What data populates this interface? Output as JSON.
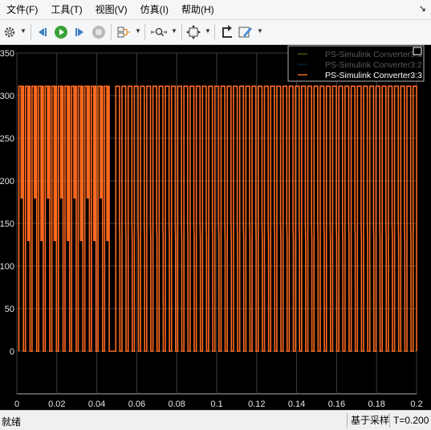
{
  "menu": {
    "items": [
      "文件(F)",
      "工具(T)",
      "视图(V)",
      "仿真(I)",
      "帮助(H)"
    ],
    "right_arrow": "↘"
  },
  "toolbar": {
    "icons": [
      "gear-icon",
      "step-back-icon",
      "run-icon",
      "step-forward-icon",
      "stop-icon",
      "signal-select-icon",
      "zoom-icon",
      "fit-view-icon",
      "restore-icon",
      "style-icon"
    ]
  },
  "status": {
    "text": "就绪",
    "sample": "基于采样",
    "time": "T=0.200"
  },
  "colors": {
    "background": "#000000",
    "axes_text": "#e6e6e6",
    "grid": "#3c3c3c",
    "series1": "#ffff00",
    "series2": "#0072bd",
    "series3": "#ff6a1f"
  },
  "chart_data": {
    "type": "line",
    "title": "",
    "xlabel": "",
    "ylabel": "",
    "xlim": [
      0,
      0.2
    ],
    "ylim": [
      -50,
      350
    ],
    "xticks": [
      "0",
      "0.02",
      "0.04",
      "0.06",
      "0.08",
      "0.1",
      "0.12",
      "0.14",
      "0.16",
      "0.18",
      "0.2"
    ],
    "yticks": [
      "0",
      "50",
      "100",
      "150",
      "200",
      "250",
      "300",
      "350"
    ],
    "grid": true,
    "legend_position": "top-right",
    "series": [
      {
        "name": "PS-Simulink Converter3:1",
        "values": [],
        "hidden": true
      },
      {
        "name": "PS-Simulink Converter3:2",
        "values": [],
        "hidden": true
      },
      {
        "name": "PS-Simulink Converter3:3",
        "description_segments": [
          {
            "t_start": 0.001,
            "t_end": 0.0462,
            "period": 0.0033,
            "duty": 0.5,
            "high": 311,
            "low": 0,
            "plateaus": [
              180,
              130
            ],
            "second_high": 311
          },
          {
            "t_start": 0.0495,
            "t_end": 0.2,
            "period": 0.0031,
            "duty": 0.5,
            "high": 311,
            "low": 0,
            "knee": 150
          }
        ]
      }
    ]
  }
}
